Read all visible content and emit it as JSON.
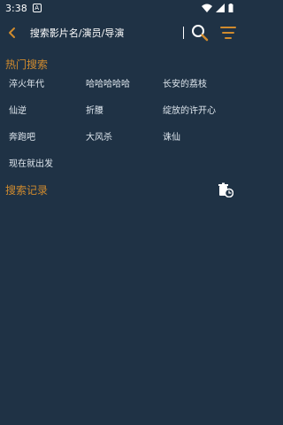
{
  "status_bar": {
    "time": "3:38",
    "notification_icon": "A"
  },
  "header": {
    "search_placeholder": "搜索影片名/演员/导演",
    "icons": [
      "back-arrow-icon",
      "search-icon",
      "filter-icon"
    ]
  },
  "hot_search": {
    "title": "热门搜索",
    "items": [
      "淬火年代",
      "哈哈哈哈哈",
      "长安的荔枝",
      "仙逆",
      "折腰",
      "绽放的许开心",
      "奔跑吧",
      "大风杀",
      "诛仙",
      "现在就出发"
    ]
  },
  "history": {
    "title": "搜索记录",
    "clear_icon": "delete-history-icon"
  },
  "colors": {
    "background": "#1f3245",
    "accent": "#d08b2e",
    "text": "#dfe7ee"
  }
}
